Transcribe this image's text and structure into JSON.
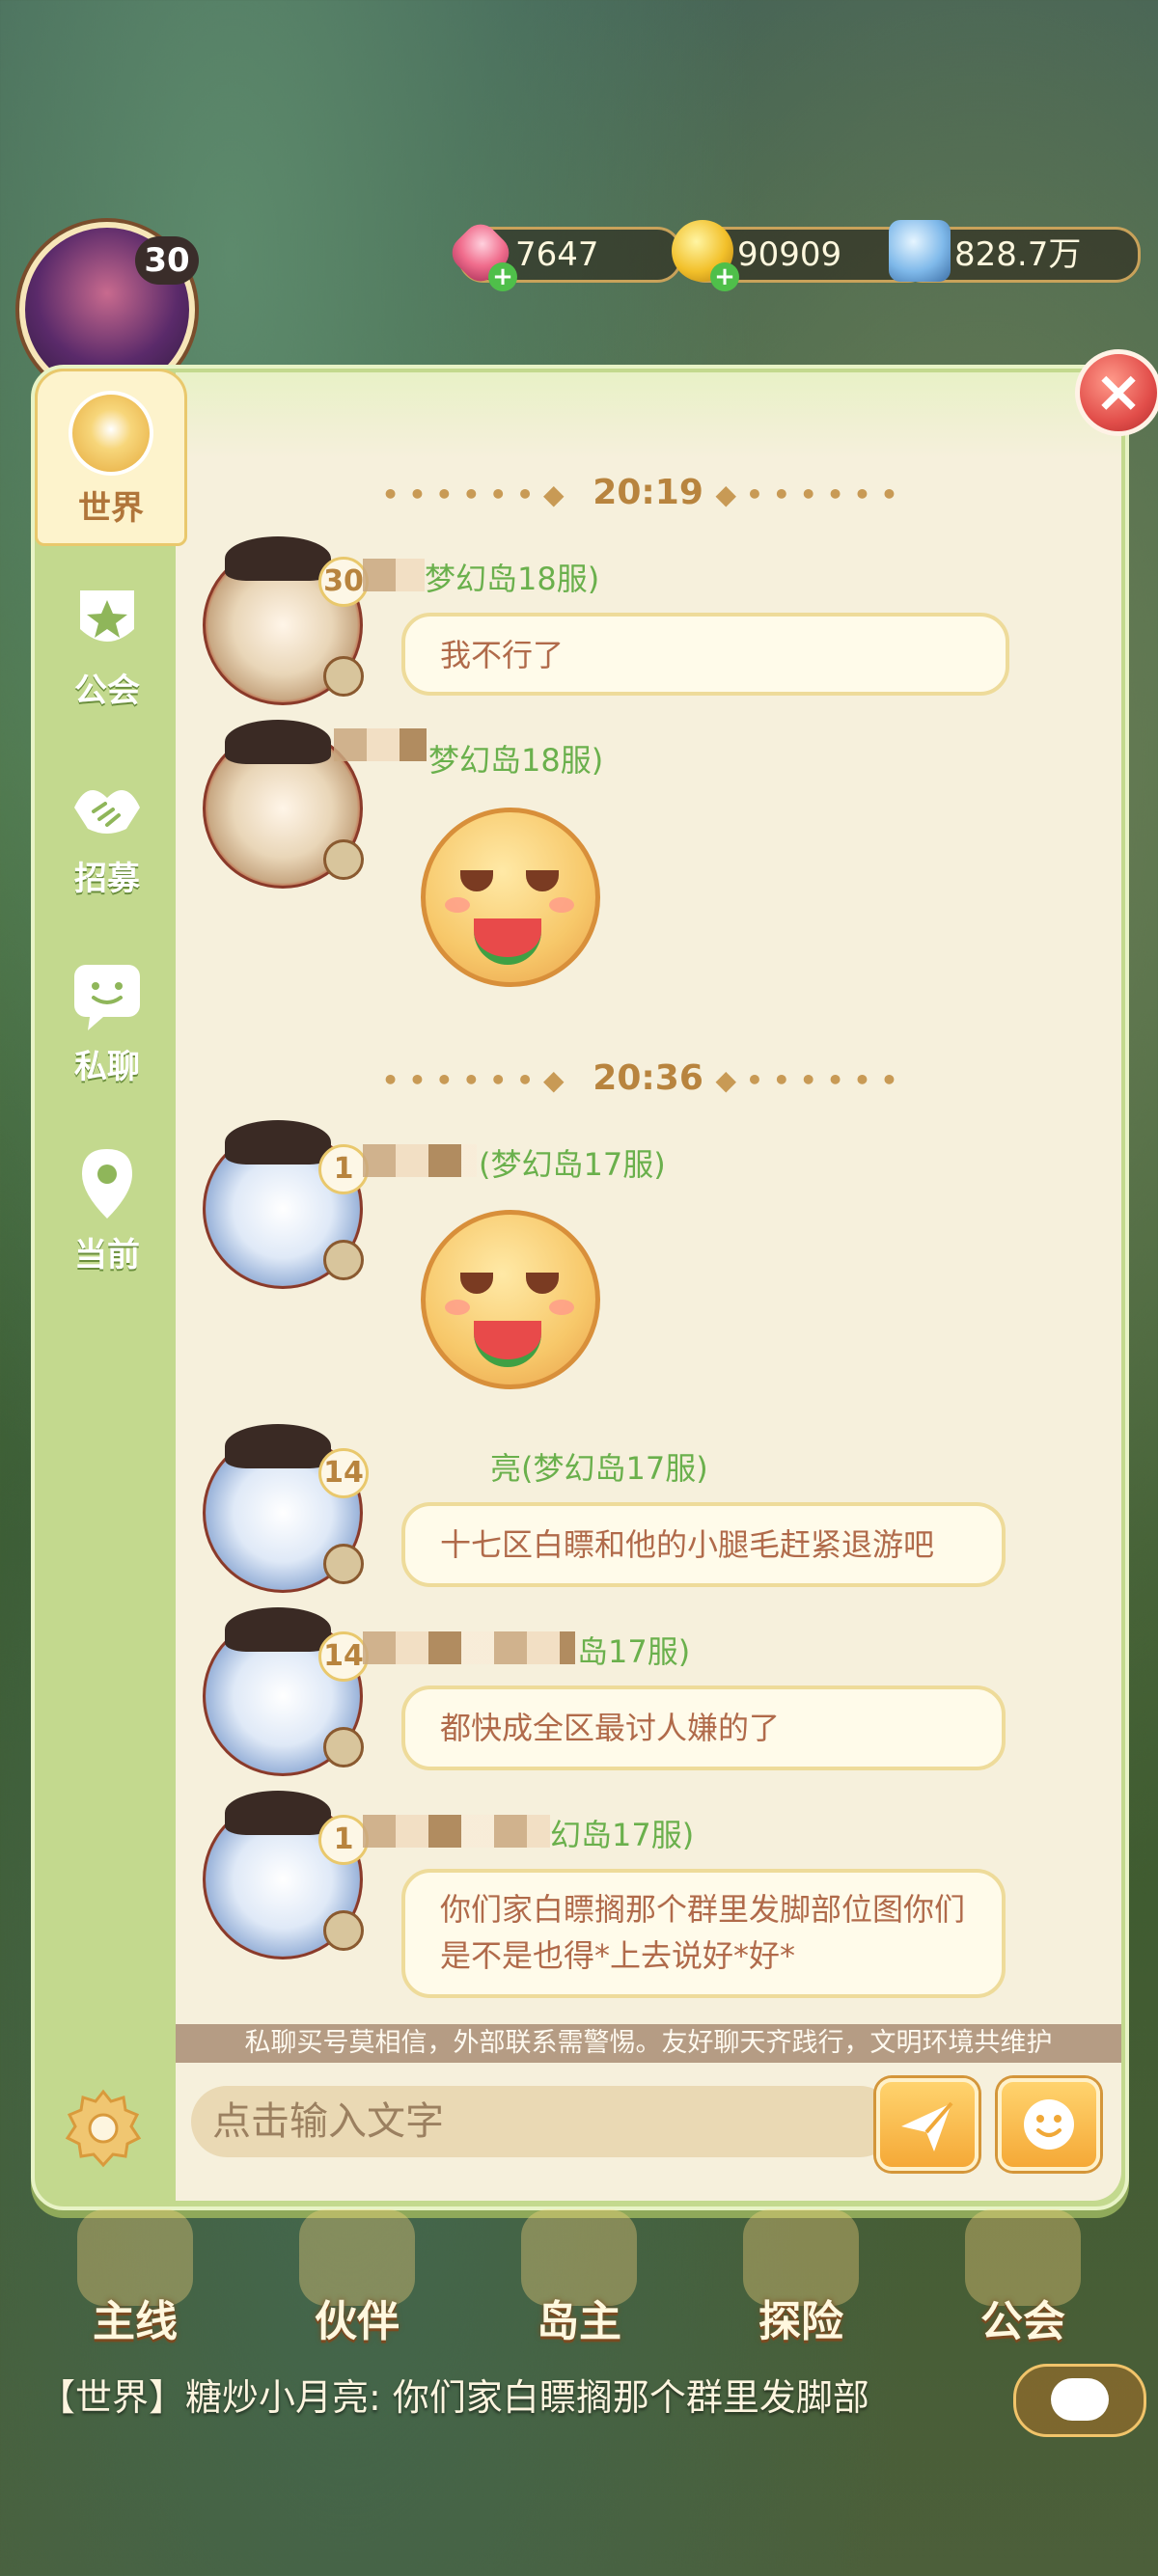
{
  "hud": {
    "level": "30",
    "gems": "7647",
    "coins": "90909",
    "power": "828.7万"
  },
  "sidebar": {
    "tabs": [
      {
        "label": "世界",
        "icon": "globe-icon",
        "active": true
      },
      {
        "label": "公会",
        "icon": "guild-badge-icon"
      },
      {
        "label": "招募",
        "icon": "handshake-icon"
      },
      {
        "label": "私聊",
        "icon": "chat-bubble-icon"
      },
      {
        "label": "当前",
        "icon": "location-pin-icon"
      }
    ]
  },
  "chat": {
    "time1": "20:19",
    "time2": "20:36",
    "messages": [
      {
        "level": "30",
        "name_suffix": "梦幻岛18服)",
        "text": "我不行了"
      },
      {
        "name_suffix": "梦幻岛18服)",
        "sticker": "watermelon-emoji"
      },
      {
        "level": "1",
        "name_suffix": "(梦幻岛17服)",
        "sticker": "watermelon-emoji"
      },
      {
        "level": "14",
        "name_suffix": "亮(梦幻岛17服)",
        "text": "十七区白瞟和他的小腿毛赶紧退游吧"
      },
      {
        "level": "14",
        "name_suffix": "岛17服)",
        "text": "都快成全区最讨人嫌的了"
      },
      {
        "level": "1",
        "name_suffix": "幻岛17服)",
        "text": "你们家白瞟搁那个群里发脚部位图你们是不是也得*上去说好*好*"
      }
    ],
    "notice": "私聊买号莫相信，外部联系需警惕。友好聊天齐践行，文明环境共维护",
    "input_placeholder": "点击输入文字"
  },
  "bottom_nav": [
    "主线",
    "伙伴",
    "岛主",
    "探险",
    "公会"
  ],
  "ticker": "【世界】糖炒小月亮: 你们家白瞟搁那个群里发脚部"
}
